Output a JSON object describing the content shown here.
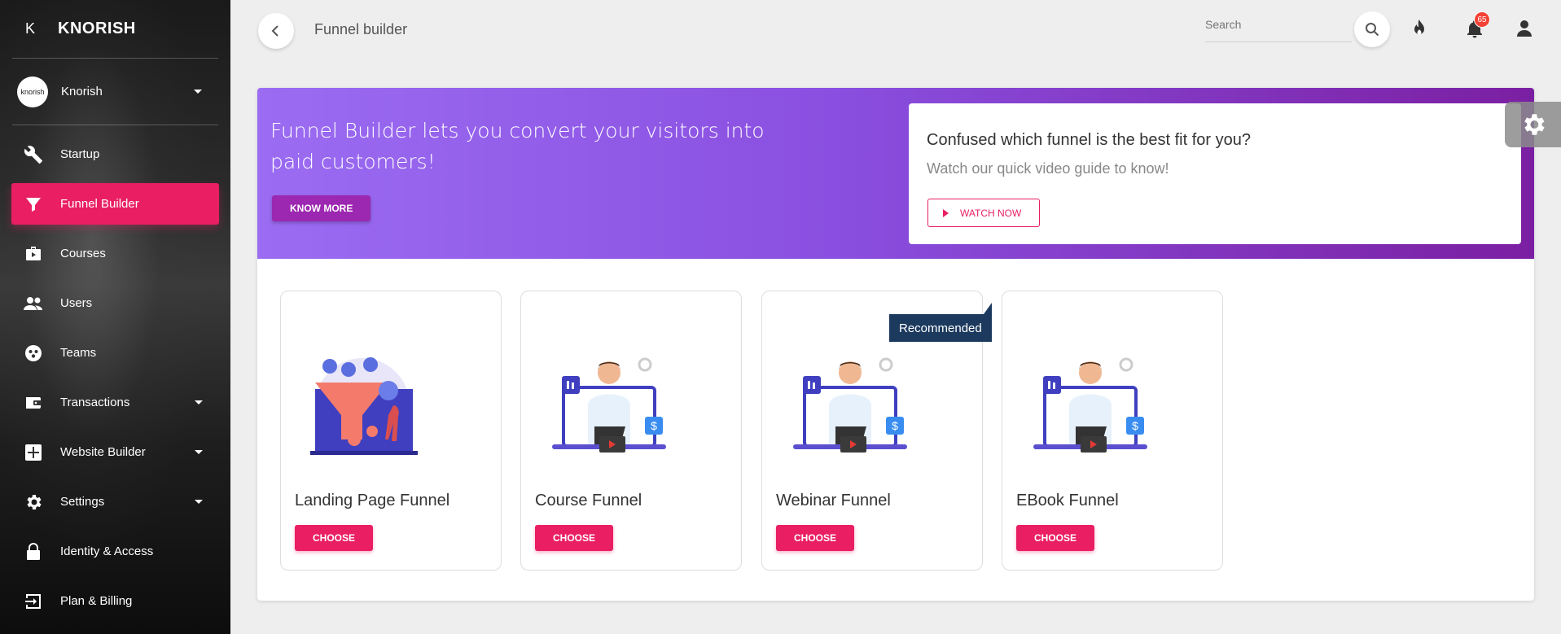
{
  "sidebar": {
    "brand_mini": "K",
    "brand_name": "KNORISH",
    "user": {
      "name": "Knorish",
      "avatar_text": "knorish"
    },
    "items": [
      {
        "label": "Startup",
        "icon": "wrench-icon"
      },
      {
        "label": "Funnel Builder",
        "icon": "funnel-icon",
        "active": true
      },
      {
        "label": "Courses",
        "icon": "briefcase-play-icon"
      },
      {
        "label": "Users",
        "icon": "users-icon"
      },
      {
        "label": "Teams",
        "icon": "teams-icon"
      },
      {
        "label": "Transactions",
        "icon": "wallet-icon",
        "expandable": true
      },
      {
        "label": "Website Builder",
        "icon": "puzzle-icon",
        "expandable": true
      },
      {
        "label": "Settings",
        "icon": "gear-icon",
        "expandable": true
      },
      {
        "label": "Identity & Access",
        "icon": "lock-icon"
      },
      {
        "label": "Plan & Billing",
        "icon": "exit-icon"
      }
    ]
  },
  "header": {
    "title": "Funnel builder",
    "search_placeholder": "Search",
    "notification_count": "65"
  },
  "banner": {
    "headline": "Funnel Builder lets you convert your visitors into paid customers!",
    "know_more_label": "KNOW MORE",
    "info_title": "Confused which funnel is the best fit for you?",
    "info_subtitle": "Watch our quick video guide to know!",
    "watch_label": "WATCH NOW"
  },
  "funnels": [
    {
      "name": "Landing Page Funnel",
      "choose_label": "CHOOSE"
    },
    {
      "name": "Course Funnel",
      "choose_label": "CHOOSE"
    },
    {
      "name": "Webinar Funnel",
      "choose_label": "CHOOSE"
    },
    {
      "name": "EBook Funnel",
      "choose_label": "CHOOSE"
    }
  ],
  "recommended_label": "Recommended",
  "colors": {
    "accent": "#e91e63",
    "purple": "#9c27b0",
    "tag": "#1c3a5e"
  }
}
